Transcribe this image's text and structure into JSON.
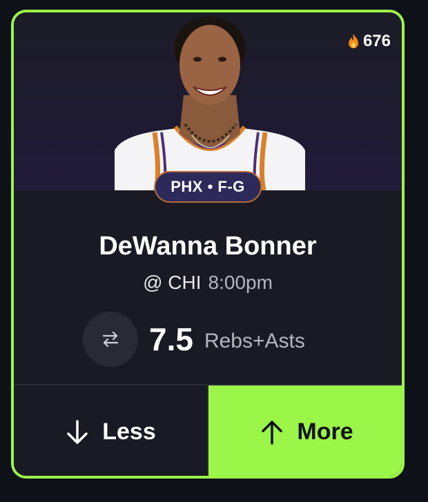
{
  "card": {
    "popularity_count": "676",
    "popularity_icon": "fire-icon",
    "team_position": "PHX • F-G",
    "player_name": "DeWanna Bonner",
    "opponent": "@ CHI",
    "game_time": "8:00pm",
    "line_value": "7.5",
    "stat_type": "Rebs+Asts",
    "swap_icon": "swap-arrows-icon"
  },
  "actions": {
    "less_label": "Less",
    "less_icon": "arrow-down-icon",
    "more_label": "More",
    "more_icon": "arrow-up-icon"
  },
  "colors": {
    "accent": "#9cf549",
    "card_bg": "#1a1a24",
    "page_bg": "#0f1118",
    "pill_bg": "#2d2a5a",
    "pill_border": "#b96a3a"
  }
}
